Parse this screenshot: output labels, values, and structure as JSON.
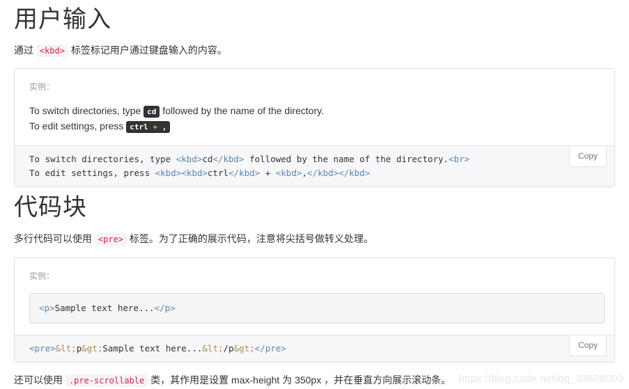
{
  "sections": [
    {
      "heading": "用户输入",
      "description": {
        "before": "通过 ",
        "code": "<kbd>",
        "after": " 标签标记用户通过键盘输入的内容。"
      },
      "example": {
        "label": "实例：",
        "line1_pre": "To switch directories, type ",
        "line1_kbd": "cd",
        "line1_post": " followed by the name of the directory.",
        "line2_pre": "To edit settings, press ",
        "line2_kbd_ctrl": "ctrl",
        "line2_kbd_plus": " + ",
        "line2_kbd_comma": ","
      },
      "code": {
        "line1": "To switch directories, type <kbd>cd</kbd> followed by the name of the directory.<br>",
        "line2": "To edit settings, press <kbd><kbd>ctrl</kbd> + <kbd>,</kbd></kbd>",
        "copy_label": "Copy"
      }
    },
    {
      "heading": "代码块",
      "description": {
        "before": "多行代码可以使用 ",
        "code": "<pre>",
        "after": " 标签。为了正确的展示代码，注意将尖括号做转义处理。"
      },
      "example": {
        "label": "实例：",
        "sample": "<p>Sample text here...</p>"
      },
      "code": {
        "line1": "<pre>&lt;p&gt;Sample text here...&lt;/p&gt;</pre>",
        "copy_label": "Copy"
      }
    }
  ],
  "footer": {
    "before": "还可以使用 ",
    "code": ".pre-scrollable",
    "middle": " 类，其作用是设置 max-height 为 350px ，并在垂直方向展示滚动条。"
  },
  "watermark": "https://blog.csdn.net/qq_33608000",
  "colors": {
    "inline_code_bg": "#f9f2f4",
    "inline_code_fg": "#c7254e",
    "kbd_bg": "#333333",
    "panel_border": "#dddddd",
    "code_bg": "#f7f7f9",
    "tag": "#5a86b5"
  }
}
